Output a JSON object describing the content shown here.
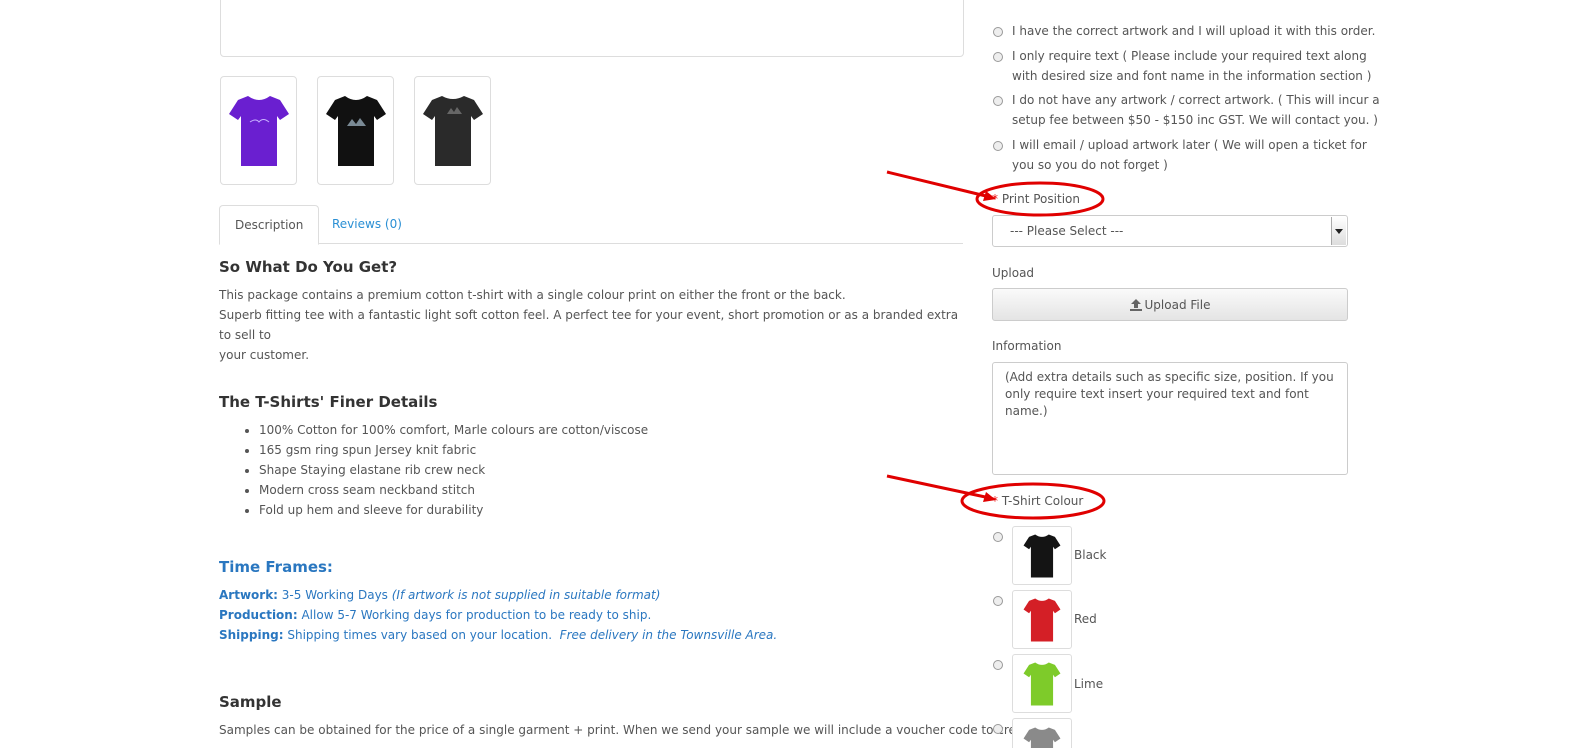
{
  "gallery": {
    "thumbnails": [
      {
        "name": "purple-tshirt-thumbnail",
        "color": "#6a1fd0"
      },
      {
        "name": "black-tshirt-front-thumbnail",
        "color": "#111111"
      },
      {
        "name": "black-tshirt-back-thumbnail",
        "color": "#2a2a2a"
      }
    ]
  },
  "tabs": {
    "description": "Description",
    "reviews": "Reviews (0)"
  },
  "description": {
    "heading": "So What Do You Get?",
    "line1": "This package contains a premium cotton t-shirt with a single colour print on either the front or the back.",
    "line2": "Superb fitting tee with a fantastic light soft cotton feel.  A perfect tee for your event, short promotion or as a branded extra to sell to",
    "line3": "your customer."
  },
  "details": {
    "heading": "The T-Shirts' Finer Details",
    "items": [
      "100% Cotton for 100% comfort, Marle colours are cotton/viscose",
      "165 gsm ring spun Jersey knit fabric",
      "Shape Staying elastane rib crew neck",
      "Modern cross seam neckband stitch",
      "Fold up hem and sleeve for durability"
    ]
  },
  "timeframes": {
    "heading": "Time Frames:",
    "artwork_label": "Artwork:",
    "artwork_text": "3-5 Working Days",
    "artwork_note": "(If artwork is not supplied in suitable format)",
    "production_label": "Production:",
    "production_text": "Allow 5-7 Working days for production to be ready to ship.",
    "shipping_label": "Shipping:",
    "shipping_text": "Shipping times vary based on your location.",
    "shipping_note": "Free delivery in the Townsville Area."
  },
  "sample": {
    "heading": "Sample",
    "text": "Samples can be obtained for the price of a single garment + print.  When we send your sample we will include a voucher code to credit"
  },
  "artwork_options": {
    "opt1": "I have the correct artwork and I will upload it with this order.",
    "opt2_l1": "I only require text ( Please include your required text along",
    "opt2_l2": "with desired size and font name in the information section )",
    "opt3_l1": "I do not have any artwork / correct artwork. ( This will incur a",
    "opt3_l2": "setup fee between $50 - $150 inc GST. We will contact you. )",
    "opt4_l1": "I will email / upload artwork later ( We will open a ticket for",
    "opt4_l2": "you so you do not forget )"
  },
  "print_position": {
    "required_mark": "*",
    "label": "Print Position",
    "selected": "--- Please Select ---"
  },
  "upload": {
    "label": "Upload",
    "button": "Upload File"
  },
  "information": {
    "label": "Information",
    "placeholder": "(Add extra details such as specific size, position.  If you only require text insert your required text and font name.)"
  },
  "tshirt_colour": {
    "required_mark": "*",
    "label": "T-Shirt Colour",
    "options": [
      {
        "name": "Black",
        "color": "#141414"
      },
      {
        "name": "Red",
        "color": "#d41f26"
      },
      {
        "name": "Lime",
        "color": "#7ecb2a"
      },
      {
        "name": "",
        "color": "#8a8a8a"
      }
    ]
  },
  "colors": {
    "annotation_red": "#e00000",
    "link_blue": "#2a8fd4",
    "heading_blue": "#2a77c0"
  }
}
